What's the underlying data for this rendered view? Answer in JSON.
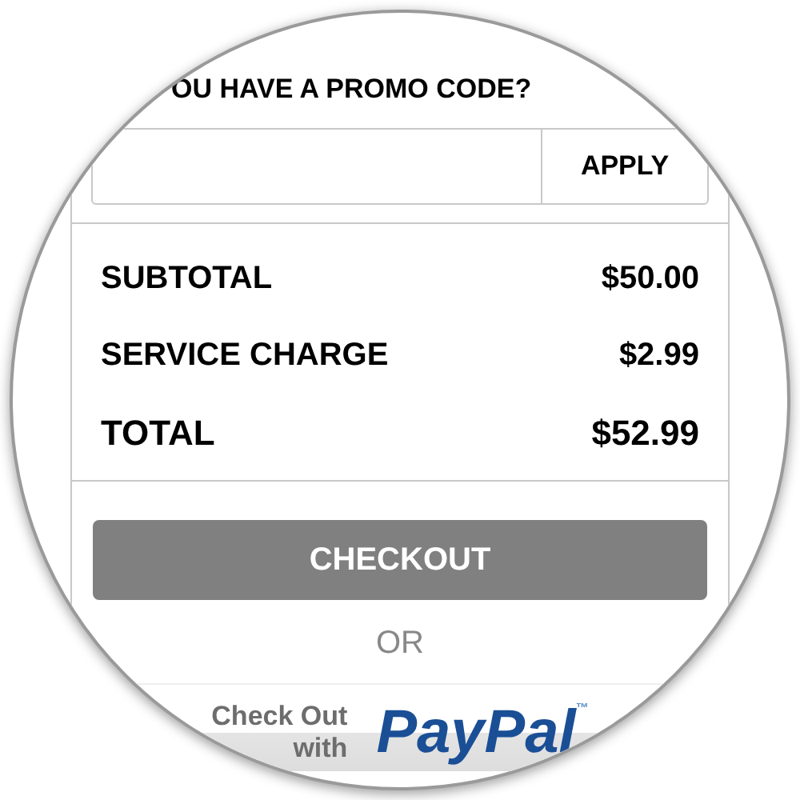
{
  "promo": {
    "heading": "OU HAVE A PROMO CODE?",
    "button": "APPLY"
  },
  "summary": [
    {
      "label": "SUBTOTAL",
      "amount": "$50.00",
      "kind": "normal"
    },
    {
      "label": "SERVICE CHARGE",
      "amount": "$2.99",
      "kind": "normal"
    },
    {
      "label": "TOTAL",
      "amount": "$52.99",
      "kind": "total"
    }
  ],
  "checkout_button": "CHECKOUT",
  "separator": "OR",
  "paypal": {
    "line_1": "Check Out",
    "line_2": "with",
    "logo": "PayPal",
    "mark": "™"
  }
}
